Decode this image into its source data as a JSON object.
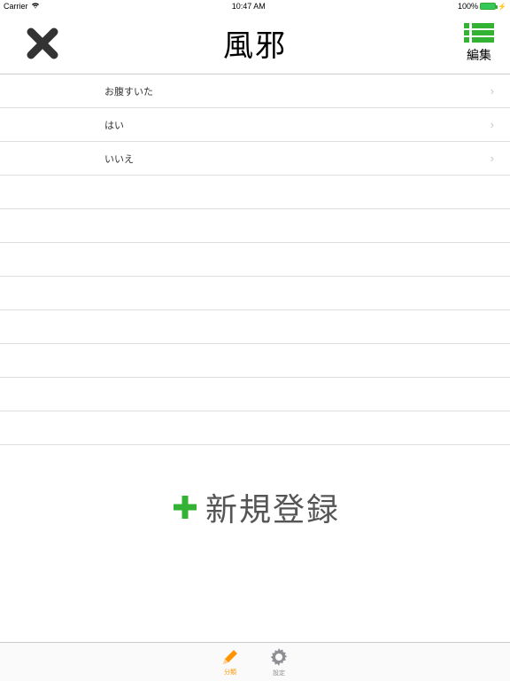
{
  "status": {
    "carrier": "Carrier",
    "time": "10:47 AM",
    "battery": "100%"
  },
  "header": {
    "title": "風邪",
    "edit_label": "編集"
  },
  "list": {
    "items": [
      {
        "label": "お腹すいた"
      },
      {
        "label": "はい"
      },
      {
        "label": "いいえ"
      }
    ],
    "empty_rows": 8
  },
  "add_new": {
    "label": "新規登録"
  },
  "tabbar": {
    "tab1_label": "分類",
    "tab2_label": "設定"
  }
}
